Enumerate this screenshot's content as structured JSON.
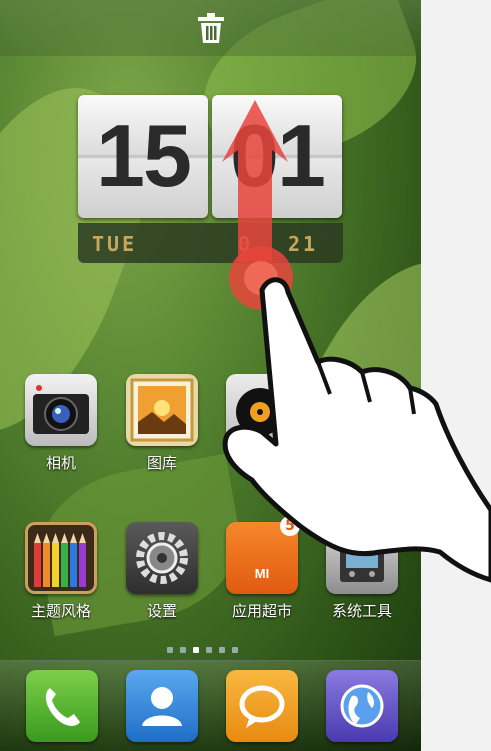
{
  "clock": {
    "hour": "15",
    "minute": "01",
    "weekday": "TUE",
    "date_partial_1": "0",
    "date_partial_2": "21"
  },
  "apps": [
    {
      "name": "相机",
      "icon": "camera-icon"
    },
    {
      "name": "图库",
      "icon": "gallery-icon"
    },
    {
      "name": "主题风格",
      "icon": "theme-icon"
    },
    {
      "name": "设置",
      "icon": "settings-icon"
    },
    {
      "name": "应用超市",
      "icon": "app-store-icon",
      "badge": "5",
      "logo": "MI"
    },
    {
      "name": "系统工具",
      "icon": "system-tools-icon"
    }
  ],
  "dock": [
    {
      "icon": "phone-icon"
    },
    {
      "icon": "contacts-icon"
    },
    {
      "icon": "messaging-icon"
    },
    {
      "icon": "browser-icon"
    }
  ],
  "page_indicator": {
    "count": 6,
    "active": 2
  },
  "colors": {
    "gesture_arrow": "#e8453c",
    "wallpaper": "#4f7d2c"
  }
}
